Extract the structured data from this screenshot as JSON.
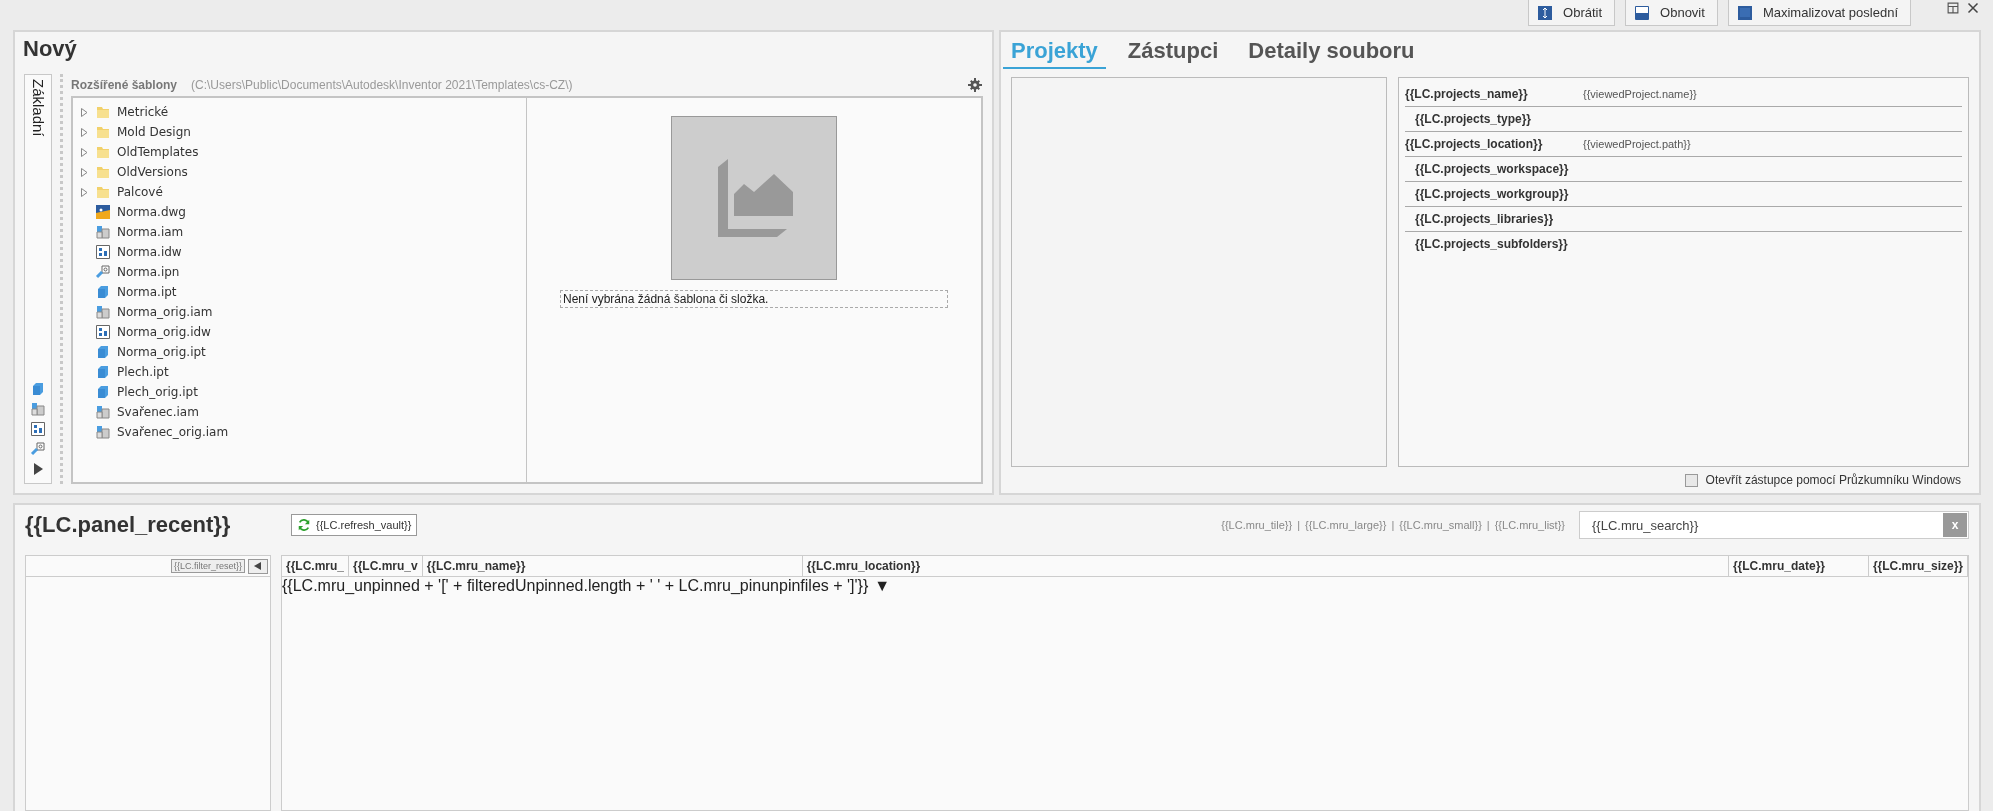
{
  "toolbar": {
    "buttons": [
      {
        "label": "Obrátit",
        "kind": "swap"
      },
      {
        "label": "Obnovit",
        "kind": "restore"
      },
      {
        "label": "Maximalizovat poslední",
        "kind": "maximize"
      }
    ]
  },
  "new_panel": {
    "title": "Nový",
    "side_tab": "Základní",
    "templates_label": "Rozšířené šablony",
    "templates_path": "(C:\\Users\\Public\\Documents\\Autodesk\\Inventor 2021\\Templates\\cs-CZ\\)",
    "tree": [
      {
        "label": "Metrické",
        "kind": "folder",
        "expanded": false
      },
      {
        "label": "Mold Design",
        "kind": "folder",
        "expanded": false
      },
      {
        "label": "OldTemplates",
        "kind": "folder",
        "expanded": false
      },
      {
        "label": "OldVersions",
        "kind": "folder",
        "expanded": false
      },
      {
        "label": "Palcové",
        "kind": "folder",
        "expanded": false
      },
      {
        "label": "Norma.dwg",
        "kind": "dwg"
      },
      {
        "label": "Norma.iam",
        "kind": "iam"
      },
      {
        "label": "Norma.idw",
        "kind": "idw"
      },
      {
        "label": "Norma.ipn",
        "kind": "ipn"
      },
      {
        "label": "Norma.ipt",
        "kind": "ipt"
      },
      {
        "label": "Norma_orig.iam",
        "kind": "iam"
      },
      {
        "label": "Norma_orig.idw",
        "kind": "idw"
      },
      {
        "label": "Norma_orig.ipt",
        "kind": "ipt"
      },
      {
        "label": "Plech.ipt",
        "kind": "ipt"
      },
      {
        "label": "Plech_orig.ipt",
        "kind": "ipt"
      },
      {
        "label": "Svařenec.iam",
        "kind": "iam"
      },
      {
        "label": "Svařenec_orig.iam",
        "kind": "iam"
      }
    ],
    "preview_caption": "Není vybrána žádná šablona či složka."
  },
  "projects_panel": {
    "tabs": [
      {
        "label": "Projekty",
        "selected": true
      },
      {
        "label": "Zástupci",
        "selected": false
      },
      {
        "label": "Detaily souboru",
        "selected": false
      }
    ],
    "details": [
      {
        "label": "{{LC.projects_name}}",
        "value": "{{viewedProject.name}}"
      },
      {
        "label": "{{LC.projects_type}}"
      },
      {
        "label": "{{LC.projects_location}}",
        "value": "{{viewedProject.path}}"
      },
      {
        "label": "{{LC.projects_workspace}}"
      },
      {
        "label": "{{LC.projects_workgroup}}"
      },
      {
        "label": "{{LC.projects_libraries}}"
      },
      {
        "label": "{{LC.projects_subfolders}}"
      }
    ],
    "explorer_option": {
      "label": "Otevřít zástupce pomocí Průzkumníku Windows",
      "checked": false
    }
  },
  "recent_panel": {
    "title": "{{LC.panel_recent}}",
    "refresh_button": "{{LC.refresh_vault}}",
    "views": [
      {
        "label": "{{LC.mru_tile}}",
        "separator": "|"
      },
      {
        "label": "{{LC.mru_large}}",
        "separator": "|"
      },
      {
        "label": "{{LC.mru_small}}",
        "separator": "|"
      },
      {
        "label": "{{LC.mru_list}}"
      }
    ],
    "search": {
      "placeholder": "{{LC.mru_search}}",
      "clear": "x"
    },
    "filter_reset": "{{LC.filter_reset}}",
    "columns": [
      "{{LC.mru_",
      "{{LC.mru_v",
      "{{LC.mru_name}}",
      "{{LC.mru_location}}",
      "{{LC.mru_date}}",
      "{{LC.mru_size}}"
    ],
    "group_row": {
      "label": "{{LC.mru_unpinned + '[' + filteredUnpinned.length + ' ' + LC.mru_pinunpinfiles + ']'}}",
      "toggle": "▼"
    }
  }
}
